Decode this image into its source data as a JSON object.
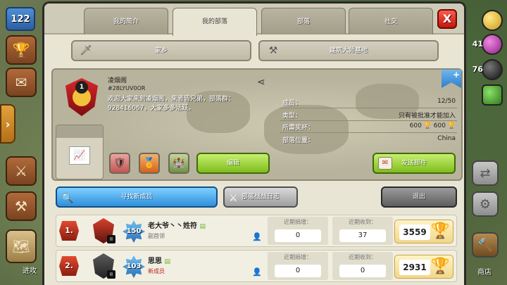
{
  "hud": {
    "level": "122",
    "attack_label": "进攻",
    "shop_label": "商店",
    "resources": [
      "41",
      "76"
    ]
  },
  "tabs": [
    {
      "label": "我的简介"
    },
    {
      "label": "我的部落"
    },
    {
      "label": "部落"
    },
    {
      "label": "社交"
    }
  ],
  "close_label": "X",
  "subtabs": {
    "home": "家乡",
    "builder_base": "建筑大师基地"
  },
  "clan": {
    "level": "1",
    "name": "凌烟阁",
    "tag": "#28LYUV0OR",
    "description": "欢迎大家来到凌烟阁，来者皆兄弟，部落群：928416067，大家多多活跃。",
    "edit_label": "编辑",
    "send_mail_label": "发送邮件",
    "info": [
      {
        "label": "成员：",
        "value": "12/50"
      },
      {
        "label": "类型：",
        "value": "只有被批准才能加入"
      },
      {
        "label": "所需奖杯：",
        "value": "600 🏆   600 🏆"
      },
      {
        "label": "部落位置：",
        "value": "China"
      }
    ]
  },
  "actions": {
    "find_members": "寻找新成员",
    "war_log": "部落战战日志",
    "leave": "退出"
  },
  "member_labels": {
    "donated": "近期捐增：",
    "received": "近期收到："
  },
  "members": [
    {
      "rank": "1.",
      "league_num": "II",
      "xp": "150",
      "name": "老大爷丶丶姓符",
      "role": "副首领",
      "donated": "0",
      "received": "37",
      "trophies": "3559"
    },
    {
      "rank": "2.",
      "league_num": "II",
      "xp": "103",
      "name": "思思",
      "role": "新成员",
      "donated": "0",
      "received": "0",
      "trophies": "2931"
    }
  ],
  "colors": {
    "accent_green": "#7fbd1c",
    "accent_blue": "#2e8fdc",
    "close_red": "#c2170c"
  }
}
